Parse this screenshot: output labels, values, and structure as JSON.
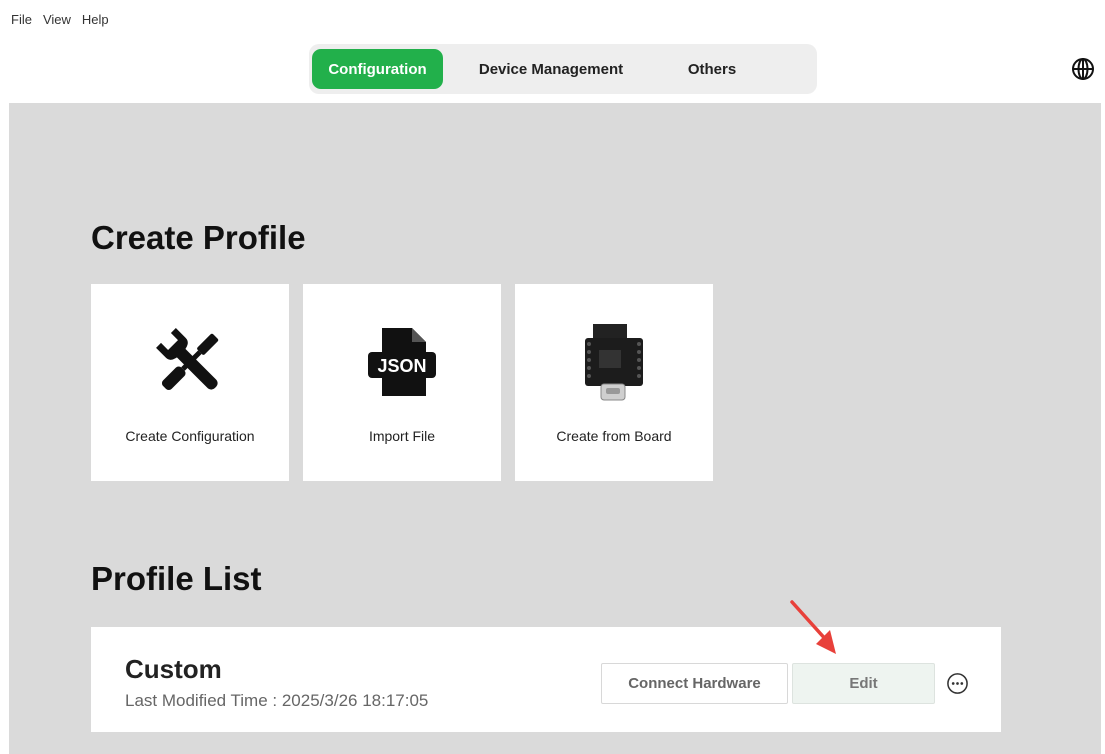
{
  "menu": {
    "file": "File",
    "view": "View",
    "help": "Help"
  },
  "tabs": [
    {
      "label": "Configuration",
      "active": true
    },
    {
      "label": "Device Management",
      "active": false
    },
    {
      "label": "Others",
      "active": false
    }
  ],
  "header": {
    "language_icon": "globe-icon"
  },
  "create_section": {
    "title": "Create Profile",
    "cards": [
      {
        "label": "Create Configuration",
        "icon": "tools-icon"
      },
      {
        "label": "Import File",
        "icon": "json-file-icon",
        "icon_text": "JSON"
      },
      {
        "label": "Create from Board",
        "icon": "board-icon"
      }
    ]
  },
  "list_section": {
    "title": "Profile List",
    "profiles": [
      {
        "name": "Custom",
        "modified": "Last Modified Time : 2025/3/26 18:17:05",
        "connect_label": "Connect Hardware",
        "edit_label": "Edit",
        "more_icon": "more-options-icon"
      }
    ]
  },
  "colors": {
    "accent": "#22b04b",
    "content_bg": "#dadada",
    "annotation_arrow": "#e8403a"
  }
}
